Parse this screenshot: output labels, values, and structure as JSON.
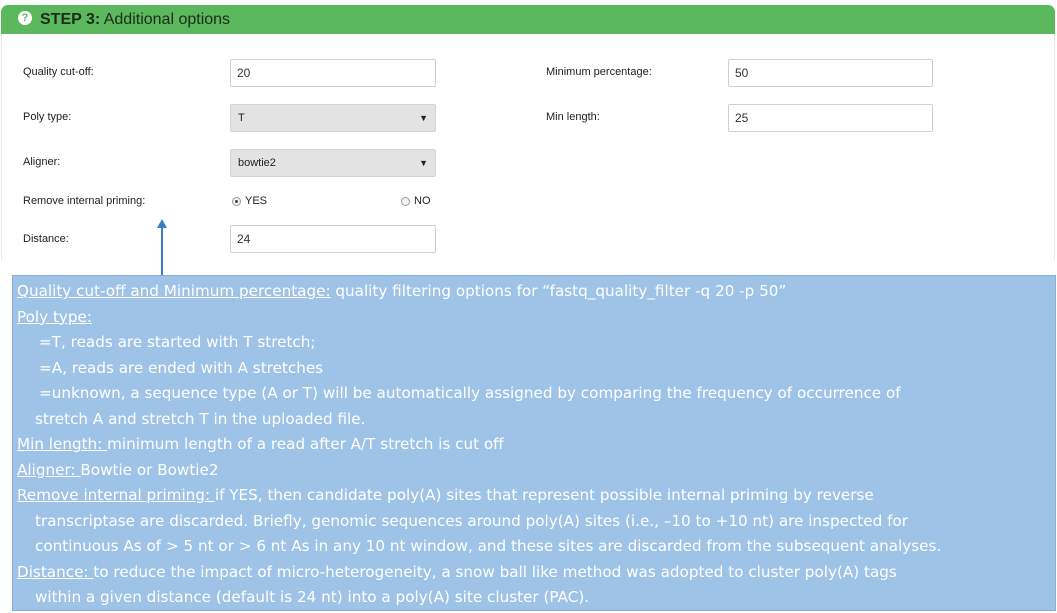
{
  "header": {
    "icon": "help-icon",
    "step": "STEP 3:",
    "title": "Additional options"
  },
  "form": {
    "quality_cutoff": {
      "label": "Quality cut-off:",
      "value": "20"
    },
    "min_percentage": {
      "label": "Minimum percentage:",
      "value": "50"
    },
    "poly_type": {
      "label": "Poly type:",
      "selected": "T"
    },
    "min_length": {
      "label": "Min length:",
      "value": "25"
    },
    "aligner": {
      "label": "Aligner:",
      "selected": "bowtie2"
    },
    "remove_internal_priming": {
      "label": "Remove internal priming:",
      "yes_label": "YES",
      "no_label": "NO",
      "selected": "YES"
    },
    "distance": {
      "label": "Distance:",
      "value": "24"
    }
  },
  "colors": {
    "header_bg": "#5cb85c",
    "note_bg": "#9ec3e6",
    "arrow": "#3b7dc4"
  },
  "note": {
    "quality_heading": "Quality cut-off and Minimum percentage:",
    "quality_text": " quality filtering options for “fastq_quality_filter -q 20 -p 50”",
    "poly_heading": "Poly type:",
    "poly_t": "=T, reads are started with T stretch;",
    "poly_a": "=A, reads are ended with A stretches",
    "poly_unknown_1": "=unknown, a sequence type (A or T) will be automatically assigned by comparing the frequency of occurrence of",
    "poly_unknown_2": "stretch A and stretch T in the uploaded file.",
    "minlen_heading": "Min length: ",
    "minlen_text": "minimum length of a read after A/T stretch is cut off",
    "aligner_heading": "Aligner: ",
    "aligner_text": "Bowtie or Bowtie2",
    "rip_heading": "Remove internal priming: ",
    "rip_text_1": " if YES, then candidate poly(A) sites that represent possible internal priming by reverse",
    "rip_text_2": "transcriptase are discarded. Briefly, genomic sequences around poly(A) sites (i.e., –10 to +10 nt) are inspected for",
    "rip_text_3": "continuous As of > 5 nt or > 6 nt As in any 10 nt window, and these sites are discarded from the subsequent analyses.",
    "distance_heading": "Distance: ",
    "distance_text_1": " to reduce the impact of micro-heterogeneity, a snow ball like method was adopted to cluster poly(A) tags",
    "distance_text_2": "within a given distance (default is 24 nt) into a poly(A) site cluster (PAC)."
  }
}
